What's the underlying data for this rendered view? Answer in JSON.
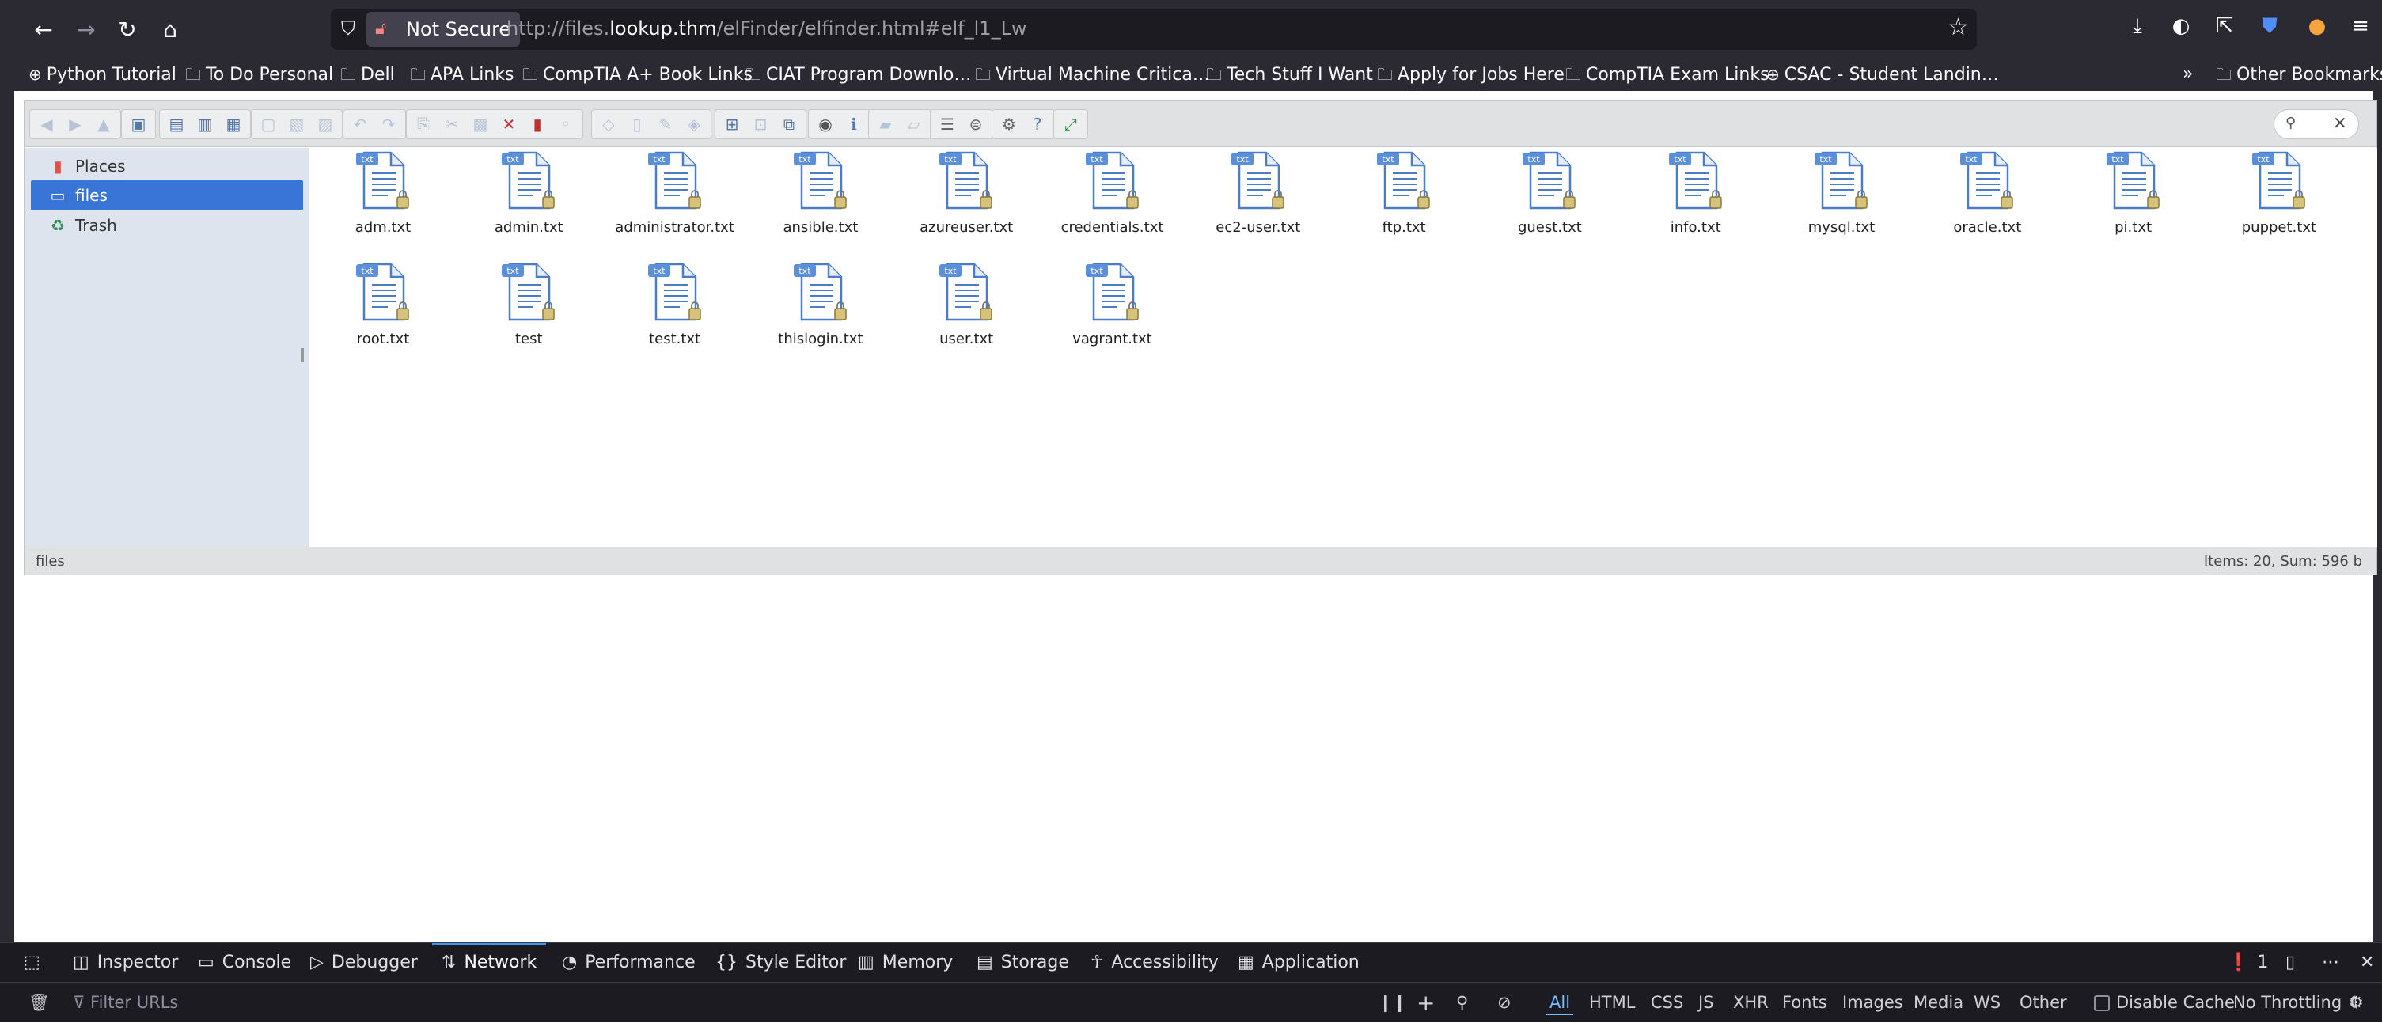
{
  "browser": {
    "security_label": "Not Secure",
    "url_scheme": "http://files.",
    "url_host": "lookup.thm",
    "url_path": "/elFinder/elfinder.html#elf_l1_Lw",
    "bookmarks": [
      {
        "label": "Python Tutorial",
        "icon": "globe-icon"
      },
      {
        "label": "To Do Personal",
        "icon": "folder-icon"
      },
      {
        "label": "Dell",
        "icon": "folder-icon"
      },
      {
        "label": "APA Links",
        "icon": "folder-icon"
      },
      {
        "label": "CompTIA A+ Book Links",
        "icon": "folder-icon"
      },
      {
        "label": "CIAT Program Downlo…",
        "icon": "folder-icon"
      },
      {
        "label": "Virtual Machine Critica…",
        "icon": "folder-icon"
      },
      {
        "label": "Tech Stuff I Want",
        "icon": "folder-icon"
      },
      {
        "label": "Apply for Jobs Here",
        "icon": "folder-icon"
      },
      {
        "label": "CompTIA Exam Links",
        "icon": "folder-icon"
      },
      {
        "label": "CSAC - Student Landin…",
        "icon": "globe-icon"
      }
    ],
    "other_bookmarks": "Other Bookmarks"
  },
  "elfinder": {
    "places": [
      {
        "label": "Places",
        "icon": "places-icon"
      },
      {
        "label": "files",
        "icon": "folder-icon",
        "selected": true
      },
      {
        "label": "Trash",
        "icon": "trash-icon"
      }
    ],
    "files": [
      {
        "name": "adm.txt",
        "badge": "txt"
      },
      {
        "name": "admin.txt",
        "badge": "txt"
      },
      {
        "name": "administrator.txt",
        "badge": "txt"
      },
      {
        "name": "ansible.txt",
        "badge": "txt"
      },
      {
        "name": "azureuser.txt",
        "badge": "txt"
      },
      {
        "name": "credentials.txt",
        "badge": "txt"
      },
      {
        "name": "ec2-user.txt",
        "badge": "txt"
      },
      {
        "name": "ftp.txt",
        "badge": "txt"
      },
      {
        "name": "guest.txt",
        "badge": "txt"
      },
      {
        "name": "info.txt",
        "badge": "txt"
      },
      {
        "name": "mysql.txt",
        "badge": "txt"
      },
      {
        "name": "oracle.txt",
        "badge": "txt"
      },
      {
        "name": "pi.txt",
        "badge": "txt"
      },
      {
        "name": "puppet.txt",
        "badge": "txt"
      },
      {
        "name": "root.txt",
        "badge": "txt"
      },
      {
        "name": "test",
        "badge": "txt"
      },
      {
        "name": "test.txt",
        "badge": "txt"
      },
      {
        "name": "thislogin.txt",
        "badge": "txt"
      },
      {
        "name": "user.txt",
        "badge": "txt"
      },
      {
        "name": "vagrant.txt",
        "badge": "txt"
      }
    ],
    "status_path": "files",
    "status_summary": "Items: 20, Sum: 596 b"
  },
  "devtools": {
    "tabs": [
      {
        "label": "Inspector",
        "icon": "inspector-icon"
      },
      {
        "label": "Console",
        "icon": "console-icon"
      },
      {
        "label": "Debugger",
        "icon": "debugger-icon"
      },
      {
        "label": "Network",
        "icon": "network-icon",
        "selected": true
      },
      {
        "label": "Performance",
        "icon": "performance-icon"
      },
      {
        "label": "Style Editor",
        "icon": "style-editor-icon"
      },
      {
        "label": "Memory",
        "icon": "memory-icon"
      },
      {
        "label": "Storage",
        "icon": "storage-icon"
      },
      {
        "label": "Accessibility",
        "icon": "accessibility-icon"
      },
      {
        "label": "Application",
        "icon": "application-icon"
      }
    ],
    "error_count": "1",
    "filter_placeholder": "Filter URLs",
    "type_filters": [
      "All",
      "HTML",
      "CSS",
      "JS",
      "XHR",
      "Fonts",
      "Images",
      "Media",
      "WS",
      "Other"
    ],
    "selected_filter": "All",
    "disable_cache_label": "Disable Cache",
    "throttling": "No Throttling"
  },
  "colors": {
    "chrome_bg": "#2b2a33",
    "selection_blue": "#3875d7",
    "nav_bg": "#dde4ee",
    "devtools_accent": "#3b99fc"
  }
}
